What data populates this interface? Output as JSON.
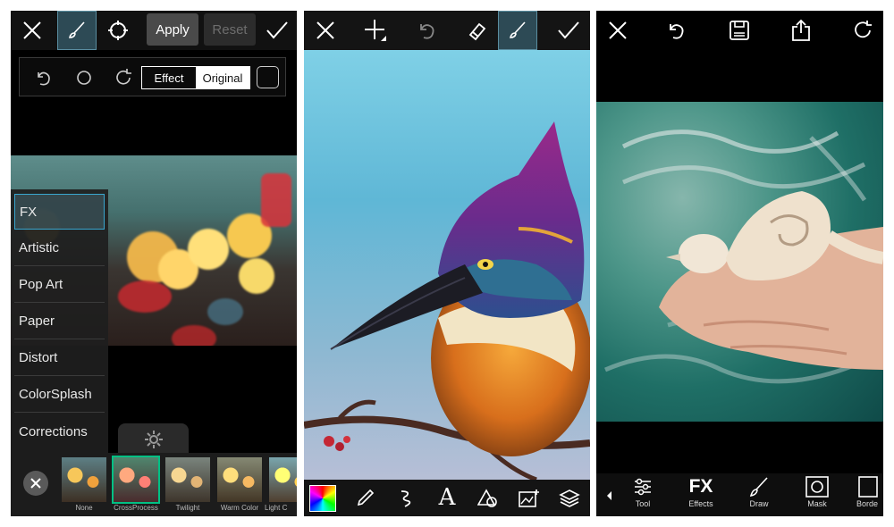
{
  "panel1": {
    "toolbar": {
      "close": "close",
      "brush": "brush",
      "circle": "circle",
      "apply_label": "Apply",
      "reset_label": "Reset",
      "confirm": "confirm"
    },
    "subbar": {
      "undo": "undo",
      "circle": "circle",
      "refresh": "refresh",
      "effect_label": "Effect",
      "original_label": "Original",
      "square": "square"
    },
    "fx_categories": [
      "FX",
      "Artistic",
      "Pop Art",
      "Paper",
      "Distort",
      "ColorSplash",
      "Corrections"
    ],
    "selected_category": "FX",
    "effects": [
      "None",
      "CrossProcess",
      "Twilight",
      "Warm Color",
      "Light C"
    ],
    "selected_effect": "CrossProcess",
    "colors": {
      "accent": "#39a6cf"
    }
  },
  "panel2": {
    "toolbar": [
      "close",
      "add",
      "undo",
      "eraser",
      "brush",
      "confirm"
    ],
    "tools": [
      "color-picker",
      "eyedropper",
      "brush-style",
      "text",
      "shapes",
      "photo",
      "layers"
    ]
  },
  "panel3": {
    "toolbar": [
      "close",
      "undo",
      "save",
      "share",
      "refresh"
    ],
    "tools": [
      {
        "name": "tool",
        "label": "Tool"
      },
      {
        "name": "effects",
        "label": "Effects",
        "icon_text": "FX"
      },
      {
        "name": "draw",
        "label": "Draw"
      },
      {
        "name": "mask",
        "label": "Mask"
      },
      {
        "name": "borders",
        "label": "Borde"
      }
    ]
  }
}
